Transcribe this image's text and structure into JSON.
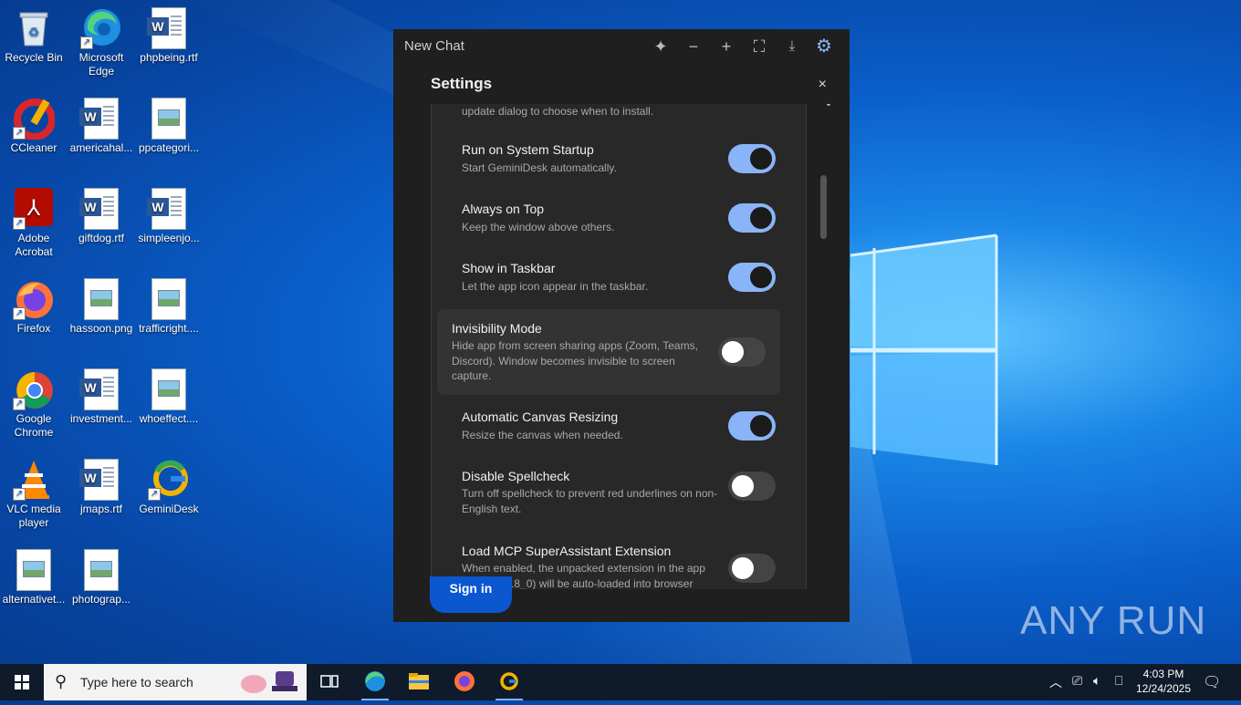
{
  "desktop": {
    "icons": [
      {
        "label": "Recycle Bin",
        "icon": "recycle-bin-icon"
      },
      {
        "label": "Microsoft Edge",
        "icon": "edge-icon"
      },
      {
        "label": "phpbeing.rtf",
        "icon": "word-doc-icon"
      },
      {
        "label": "CCleaner",
        "icon": "ccleaner-icon"
      },
      {
        "label": "americahal...",
        "icon": "word-doc-icon"
      },
      {
        "label": "ppcategori...",
        "icon": "image-file-icon"
      },
      {
        "label": "Adobe Acrobat",
        "icon": "acrobat-icon"
      },
      {
        "label": "giftdog.rtf",
        "icon": "word-doc-icon"
      },
      {
        "label": "simpleenjo...",
        "icon": "word-doc-icon"
      },
      {
        "label": "Firefox",
        "icon": "firefox-icon"
      },
      {
        "label": "hassoon.png",
        "icon": "image-file-icon"
      },
      {
        "label": "trafficright....",
        "icon": "image-file-icon"
      },
      {
        "label": "Google Chrome",
        "icon": "chrome-icon"
      },
      {
        "label": "investment...",
        "icon": "word-doc-icon"
      },
      {
        "label": "whoeffect....",
        "icon": "image-file-icon"
      },
      {
        "label": "VLC media player",
        "icon": "vlc-icon"
      },
      {
        "label": "jmaps.rtf",
        "icon": "word-doc-icon"
      },
      {
        "label": "GeminiDesk",
        "icon": "geminidesk-icon"
      },
      {
        "label": "alternativet...",
        "icon": "image-file-icon"
      },
      {
        "label": "photograp...",
        "icon": "image-file-icon"
      }
    ]
  },
  "app": {
    "title": "New Chat",
    "settings": {
      "heading": "Settings",
      "close": "×",
      "truncated_desc": "update dialog to choose when to install.",
      "items": [
        {
          "name": "Run on System Startup",
          "desc": "Start GeminiDesk automatically.",
          "on": true
        },
        {
          "name": "Always on Top",
          "desc": "Keep the window above others.",
          "on": true
        },
        {
          "name": "Show in Taskbar",
          "desc": "Let the app icon appear in the taskbar.",
          "on": true
        },
        {
          "name": "Invisibility Mode",
          "desc": "Hide app from screen sharing apps (Zoom, Teams, Discord). Window becomes invisible to screen capture.",
          "on": false
        },
        {
          "name": "Automatic Canvas Resizing",
          "desc": "Resize the canvas when needed.",
          "on": true
        },
        {
          "name": "Disable Spellcheck",
          "desc": "Turn off spellcheck to prevent red underlines on non-English text.",
          "on": false
        },
        {
          "name": "Load MCP SuperAssistant Extension",
          "desc": "When enabled, the unpacked extension in the app folder (0.5.8_0) will be auto-loaded into browser",
          "on": false
        }
      ]
    },
    "signin_label": "Sign in"
  },
  "watermark": "ANY RUN",
  "taskbar": {
    "search_placeholder": "Type here to search",
    "time": "4:03 PM",
    "date": "12/24/2025"
  }
}
